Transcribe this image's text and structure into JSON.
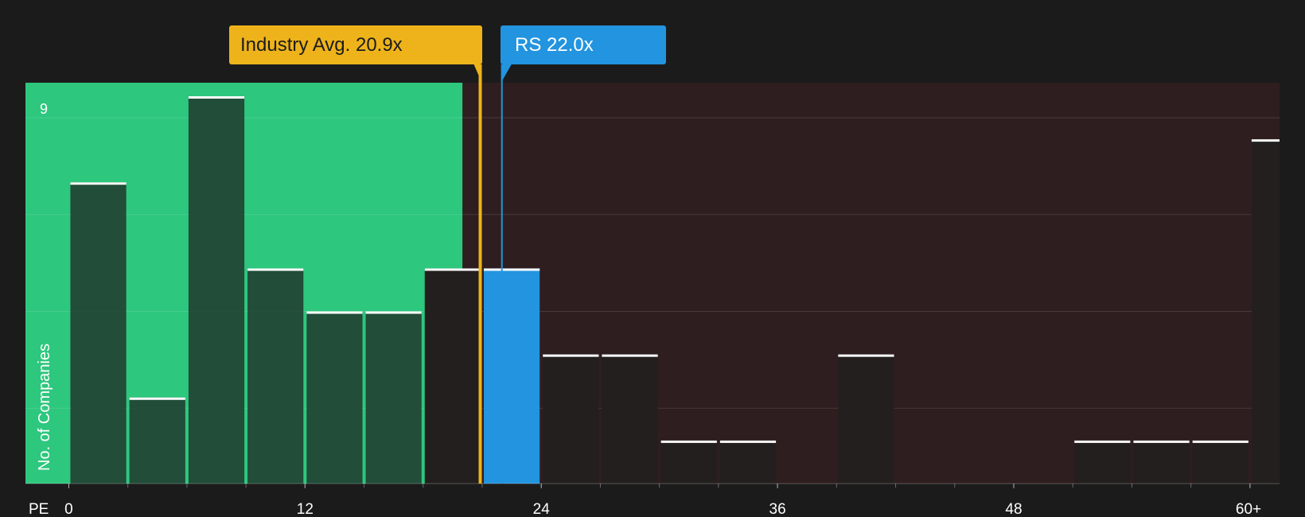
{
  "chart_data": {
    "type": "bar",
    "title": "",
    "xlabel": "PE",
    "ylabel": "No. of Companies",
    "x_ticks": [
      "0",
      "12",
      "24",
      "36",
      "48",
      "60+"
    ],
    "x_tick_values": [
      0,
      12,
      24,
      36,
      48,
      60
    ],
    "y_tick_labels": [
      "9"
    ],
    "ylim": [
      0,
      9
    ],
    "xlim": [
      -2.2,
      61.5
    ],
    "bin_width": 3,
    "bins": [
      {
        "start": 0,
        "count": 7
      },
      {
        "start": 3,
        "count": 2
      },
      {
        "start": 6,
        "count": 9
      },
      {
        "start": 9,
        "count": 5
      },
      {
        "start": 12,
        "count": 4
      },
      {
        "start": 15,
        "count": 4
      },
      {
        "start": 18,
        "count": 5
      },
      {
        "start": 21,
        "count": 5,
        "highlight": true
      },
      {
        "start": 24,
        "count": 3
      },
      {
        "start": 27,
        "count": 3
      },
      {
        "start": 30,
        "count": 1
      },
      {
        "start": 33,
        "count": 1
      },
      {
        "start": 36,
        "count": 0
      },
      {
        "start": 39,
        "count": 3
      },
      {
        "start": 42,
        "count": 0
      },
      {
        "start": 45,
        "count": 0
      },
      {
        "start": 48,
        "count": 0
      },
      {
        "start": 51,
        "count": 1
      },
      {
        "start": 54,
        "count": 1
      },
      {
        "start": 57,
        "count": 1
      },
      {
        "start": 60,
        "count": 8
      }
    ],
    "markers": [
      {
        "name": "Industry Avg.",
        "value": 20.9,
        "label": "Industry Avg. 20.9x",
        "color": "#eeb31b"
      },
      {
        "name": "RS",
        "value": 22.0,
        "label": "RS 22.0x",
        "color": "#2394df"
      }
    ],
    "regions": [
      {
        "name": "below-average",
        "from": -2.2,
        "to": 20.0,
        "color": "#2ec77e"
      },
      {
        "name": "above-average",
        "from": 20.0,
        "to": 61.5,
        "color": "#2f1e1f"
      }
    ],
    "grid": true
  }
}
